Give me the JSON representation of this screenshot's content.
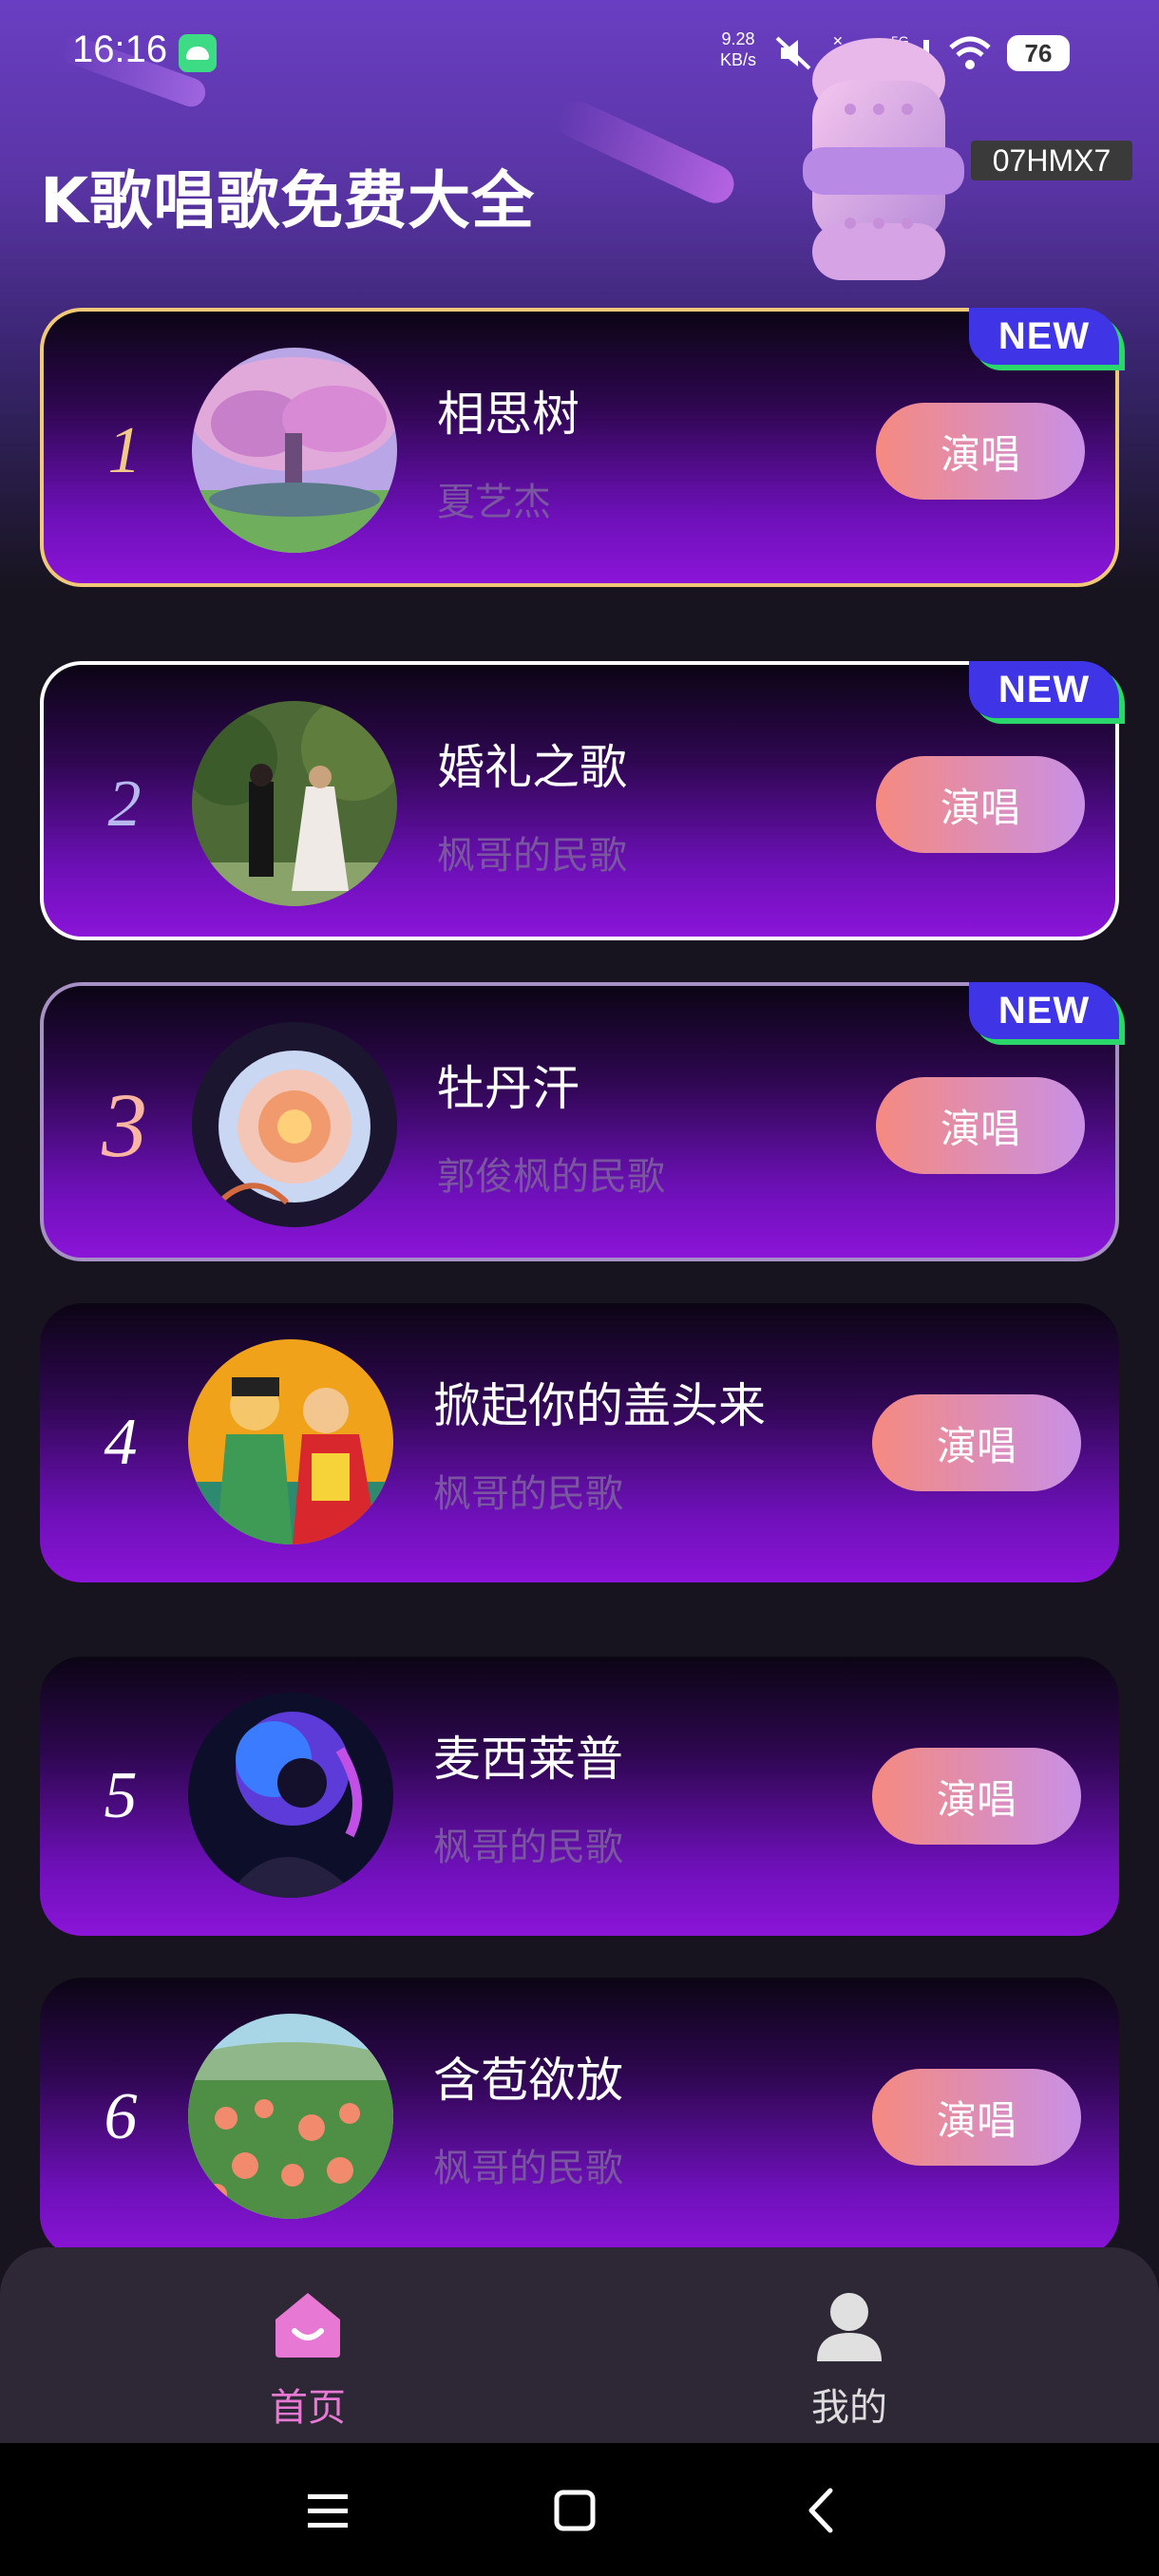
{
  "status_bar": {
    "time": "16:16",
    "net_speed_value": "9.28",
    "net_speed_unit": "KB/s",
    "network_type": "5G",
    "battery": "76"
  },
  "header": {
    "title": "K歌唱歌免费大全",
    "watermark": "07HMX7"
  },
  "songs": [
    {
      "rank": "1",
      "title": "相思树",
      "artist": "夏艺杰",
      "button": "演唱",
      "badge": "NEW"
    },
    {
      "rank": "2",
      "title": "婚礼之歌",
      "artist": "枫哥的民歌",
      "button": "演唱",
      "badge": "NEW"
    },
    {
      "rank": "3",
      "title": "牡丹汗",
      "artist": "郭俊枫的民歌",
      "button": "演唱",
      "badge": "NEW"
    },
    {
      "rank": "4",
      "title": "掀起你的盖头来",
      "artist": "枫哥的民歌",
      "button": "演唱"
    },
    {
      "rank": "5",
      "title": "麦西莱普",
      "artist": "枫哥的民歌",
      "button": "演唱"
    },
    {
      "rank": "6",
      "title": "含苞欲放",
      "artist": "枫哥的民歌",
      "button": "演唱"
    }
  ],
  "bottom_nav": {
    "home_label": "首页",
    "mine_label": "我的"
  },
  "colors": {
    "accent": "#e779d4",
    "button_start": "#f58a80",
    "button_end": "#c990e6",
    "badge": "#3f35e6"
  }
}
